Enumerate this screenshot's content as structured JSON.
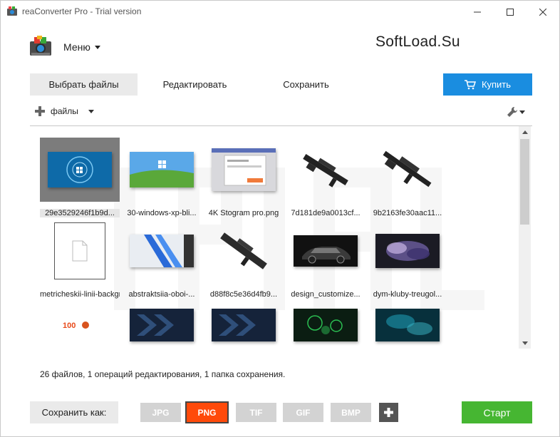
{
  "window": {
    "title": "reaConverter Pro - Trial version"
  },
  "header": {
    "menu_label": "Меню",
    "watermark": "SoftLoad.Su"
  },
  "tabs": [
    {
      "label": "Выбрать файлы",
      "active": true
    },
    {
      "label": "Редактировать",
      "active": false
    },
    {
      "label": "Сохранить",
      "active": false
    }
  ],
  "buy": {
    "label": "Купить"
  },
  "toolbar": {
    "add_label": "файлы"
  },
  "files": [
    {
      "name": "29e3529246f1b9d...",
      "selected": true
    },
    {
      "name": "30-windows-xp-bli..."
    },
    {
      "name": "4K Stogram pro.png"
    },
    {
      "name": "7d181de9a0013cf..."
    },
    {
      "name": "9b2163fe30aac11..."
    },
    {
      "name": "metricheskii-linii-background"
    },
    {
      "name": "abstraktsiia-oboi-..."
    },
    {
      "name": "d88f8c5e36d4fb9..."
    },
    {
      "name": "design_customize..."
    },
    {
      "name": "dym-kluby-treugol..."
    },
    {
      "name": ""
    },
    {
      "name": ""
    },
    {
      "name": ""
    },
    {
      "name": ""
    },
    {
      "name": ""
    }
  ],
  "thumb_text": {
    "badge": "100"
  },
  "status": "26 файлов, 1 операций редактирования, 1 папка сохранения.",
  "bottom": {
    "save_as_label": "Сохранить как:",
    "formats": [
      {
        "label": "JPG",
        "active": false
      },
      {
        "label": "PNG",
        "active": true
      },
      {
        "label": "TIF",
        "active": false
      },
      {
        "label": "GIF",
        "active": false
      },
      {
        "label": "BMP",
        "active": false
      }
    ],
    "start_label": "Старт"
  },
  "colors": {
    "accent_blue": "#1a8de0",
    "start_green": "#46b632",
    "active_format": "#ff4a0a"
  }
}
